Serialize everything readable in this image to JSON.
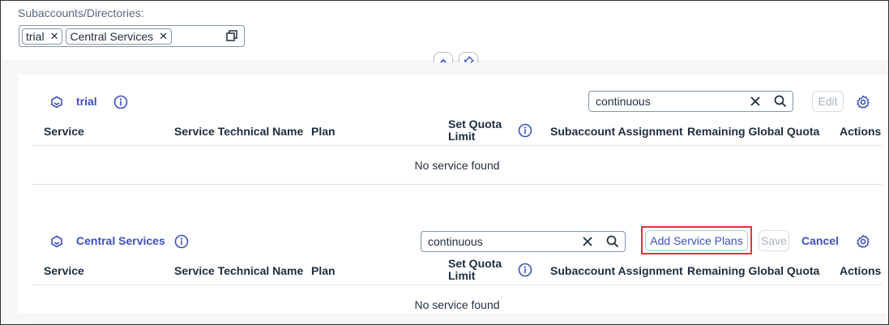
{
  "filter": {
    "label": "Subaccounts/Directories:",
    "tokens": [
      "trial",
      "Central Services"
    ]
  },
  "colors": {
    "accent": "#3c4fc2",
    "highlight": "#d9363e",
    "disabled": "#a9b4be"
  },
  "sections": [
    {
      "title": "trial",
      "search_value": "continuous",
      "edit_label": "Edit",
      "columns": {
        "service": "Service",
        "technical_name": "Service Technical Name",
        "plan": "Plan",
        "quota_line1": "Set Quota",
        "quota_line2": "Limit",
        "assignment": "Subaccount Assignment",
        "remaining": "Remaining Global Quota",
        "actions": "Actions"
      },
      "empty_text": "No service found"
    },
    {
      "title": "Central Services",
      "search_value": "continuous",
      "add_label": "Add Service Plans",
      "save_label": "Save",
      "cancel_label": "Cancel",
      "columns": {
        "service": "Service",
        "technical_name": "Service Technical Name",
        "plan": "Plan",
        "quota_line1": "Set Quota",
        "quota_line2": "Limit",
        "assignment": "Subaccount Assignment",
        "remaining": "Remaining Global Quota",
        "actions": "Actions"
      },
      "empty_text": "No service found"
    }
  ]
}
